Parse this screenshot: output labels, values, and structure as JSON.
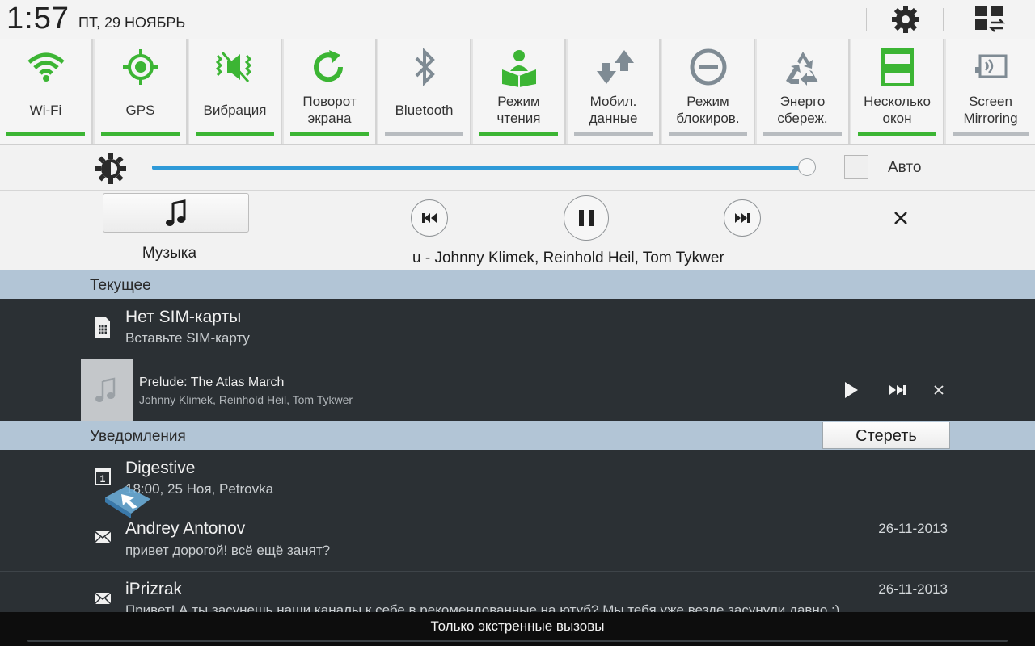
{
  "status_bar": {
    "time": "1:57",
    "date": "ПТ, 29 НОЯБРЬ"
  },
  "quick_settings": [
    {
      "label": "Wi-Fi",
      "icon": "wifi-icon",
      "on": true
    },
    {
      "label": "GPS",
      "icon": "gps-icon",
      "on": true
    },
    {
      "label": "Вибрация",
      "icon": "vibration-icon",
      "on": true
    },
    {
      "label": "Поворот экрана",
      "icon": "rotate-icon",
      "on": true
    },
    {
      "label": "Bluetooth",
      "icon": "bluetooth-icon",
      "on": false
    },
    {
      "label": "Режим чтения",
      "icon": "reading-mode-icon",
      "on": true
    },
    {
      "label": "Мобил. данные",
      "icon": "mobile-data-icon",
      "on": false
    },
    {
      "label": "Режим блокиров.",
      "icon": "blocking-mode-icon",
      "on": false
    },
    {
      "label": "Энерго сбереж.",
      "icon": "power-saving-icon",
      "on": false
    },
    {
      "label": "Несколько окон",
      "icon": "multi-window-icon",
      "on": true
    },
    {
      "label": "Screen Mirroring",
      "icon": "screen-mirroring-icon",
      "on": false
    }
  ],
  "brightness": {
    "level": 1.0,
    "auto_label": "Авто",
    "auto_checked": false
  },
  "music_panel": {
    "app_label": "Музыка",
    "track_line": "u - Johnny Klimek, Reinhold Heil, Tom Tykwer"
  },
  "sections": {
    "current": "Текущее",
    "notifications": "Уведомления",
    "clear_label": "Стереть"
  },
  "ongoing": {
    "sim": {
      "title": "Нет SIM-карты",
      "subtitle": "Вставьте SIM-карту"
    },
    "player": {
      "title": "Prelude: The Atlas March",
      "artist": "Johnny Klimek, Reinhold Heil, Tom Tykwer"
    }
  },
  "notifications": [
    {
      "title": "Digestive",
      "text": "18:00, 25 Ноя, Petrovka",
      "date": "",
      "icon": "calendar-icon"
    },
    {
      "title": "Andrey Antonov",
      "text": "привет дорогой! всё ещё занят?",
      "date": "26-11-2013",
      "icon": "mail-icon"
    },
    {
      "title": "iPrizrak",
      "text": "Привет! А ты засунешь наши каналы к себе в рекомендованные на ютуб? Мы тебя уже везде засунули давно :)",
      "date": "26-11-2013",
      "icon": "mail-icon"
    }
  ],
  "bottom_bar": {
    "label": "Только экстренные вызовы"
  },
  "colors": {
    "toggle_on": "#3cb534",
    "toggle_off": "#b8bcc0",
    "icon_green": "#3cb534",
    "icon_grey": "#7f8b94",
    "slider": "#2f9ad8",
    "section_bg": "#b2c5d6",
    "panel_dark": "#2b3034"
  }
}
